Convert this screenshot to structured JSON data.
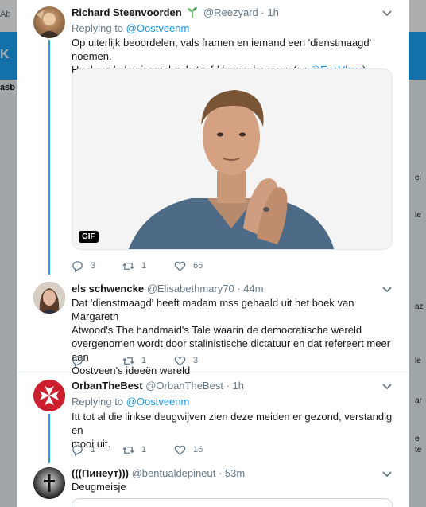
{
  "background": {
    "topbar_text": "Ab",
    "bluebar_text": "K",
    "side_text": "asb",
    "right_fragments": [
      "el",
      "le",
      "az",
      "le",
      "ar",
      "e",
      "te"
    ]
  },
  "tweets": [
    {
      "name": "Richard Steenvoorden",
      "handle": "@Reezyard",
      "time": "· 1h",
      "reply_prefix": "Replying to",
      "reply_handle": "@Oostveenm",
      "text_line1": "Op uiterlijk beoordelen, vals framen en iemand een 'dienstmaagd' noemen.",
      "text_line2_main": "Heel erg kalmpjes geboekstaafd hoor, chapeau. (cc ",
      "text_line2_link": "@EvaVlaar",
      "text_line2_end": ")",
      "gif_label": "GIF",
      "replies": "3",
      "retweets": "1",
      "likes": "66"
    },
    {
      "name": "els schwencke",
      "handle": "@Elisabethmary70",
      "time": "· 44m",
      "text_lines": [
        "Dat 'dienstmaagd' heeft madam mss gehaald uit het boek van Margareth",
        "Atwood's The handmaid's Tale waarin de democratische wereld",
        "overgenomen wordt door stalinistische dictatuur en dat refereert meer aan",
        "Oostveen's ideeën wereld"
      ],
      "replies": "",
      "retweets": "1",
      "likes": "3"
    },
    {
      "name": "OrbanTheBest",
      "handle": "@OrbanTheBest",
      "time": "· 1h",
      "reply_prefix": "Replying to",
      "reply_handle": "@Oostveenm",
      "text_lines": [
        "Itt tot al die linkse deugwijven zien deze meiden er gezond, verstandig en",
        "mooi uit."
      ],
      "replies": "1",
      "retweets": "1",
      "likes": "16"
    },
    {
      "name": "(((Пинеут)))",
      "handle": "@bentualdepineut",
      "time": "· 53m",
      "text_lines": [
        "Deugmeisje"
      ]
    }
  ],
  "colors": {
    "accent": "#1da1f2",
    "link": "#1b95e0",
    "muted": "#657786",
    "text": "#14171a",
    "orban_red": "#cc1f2d"
  }
}
